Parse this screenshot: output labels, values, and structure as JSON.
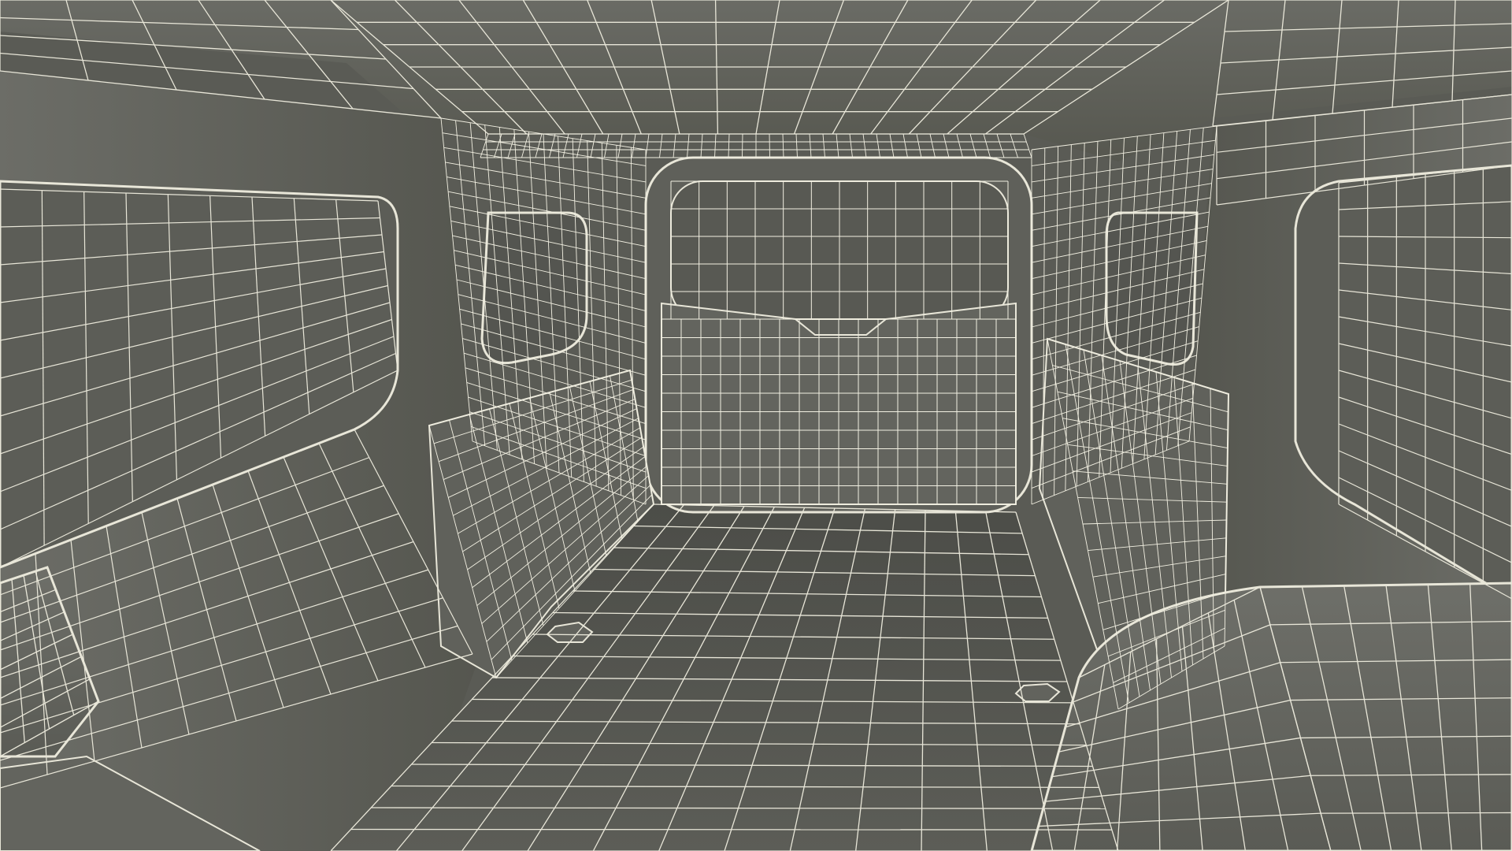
{
  "scene": {
    "subject": "wireframe-render",
    "colors": {
      "background": "#5a5b55",
      "surface_dark": "#4f504b",
      "surface_mid": "#5e5f59",
      "surface_light": "#6d6e68",
      "wire": "#e8e6d8",
      "wire_dense": "#f2f0e2"
    }
  }
}
